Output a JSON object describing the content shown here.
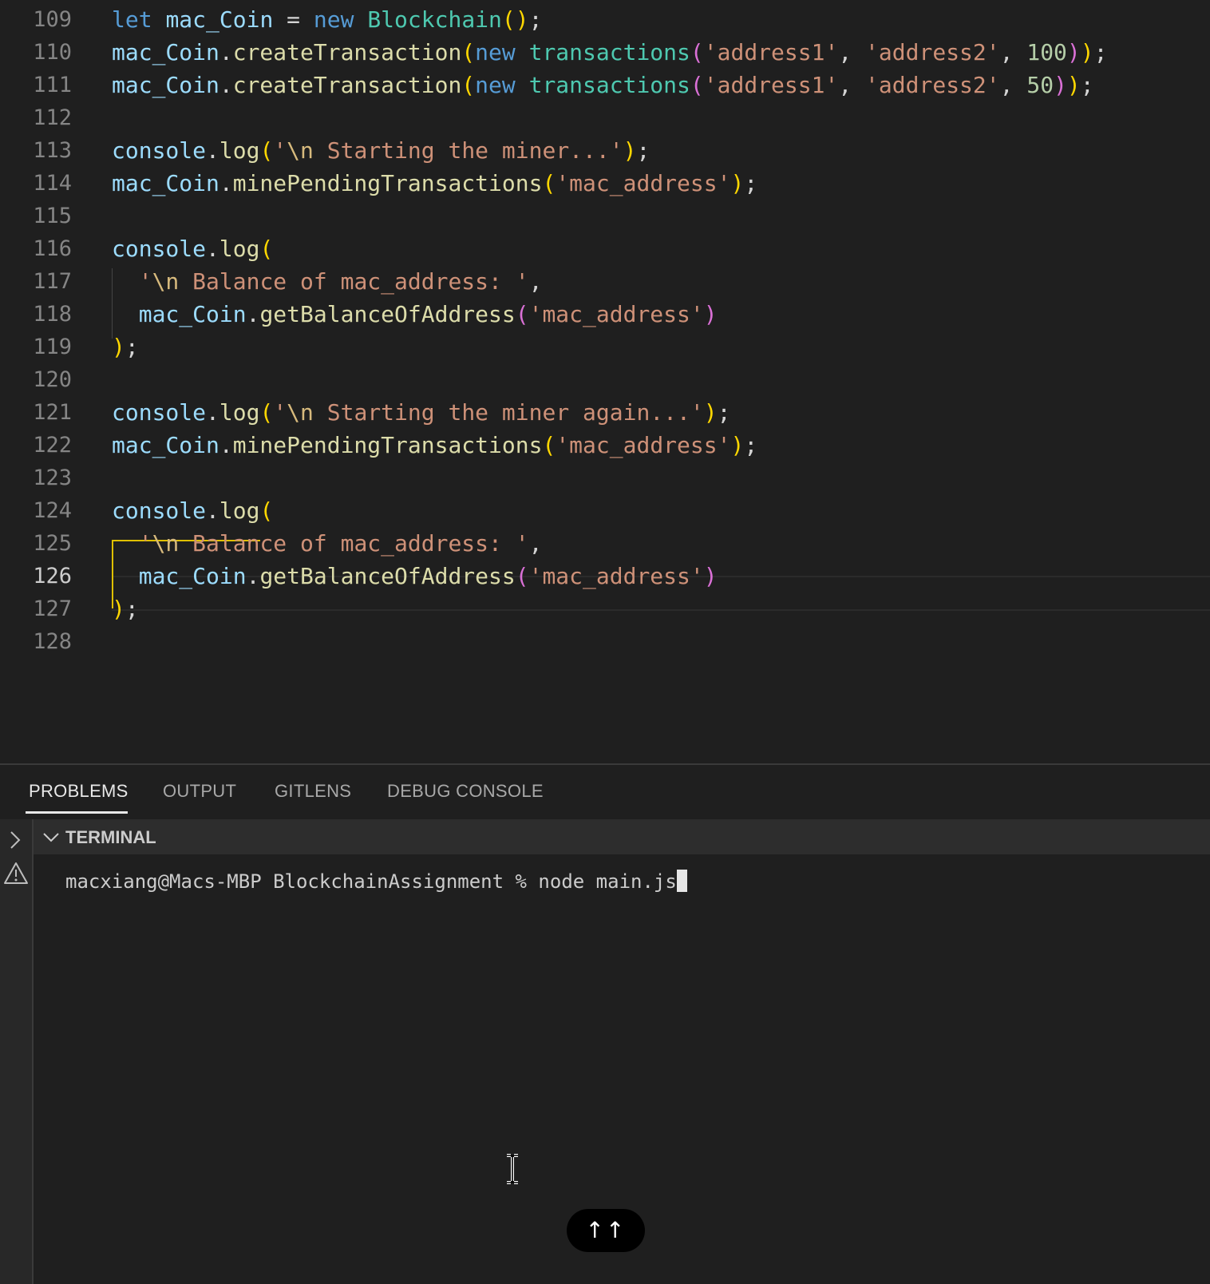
{
  "editor": {
    "lines": [
      {
        "num": "109",
        "tokens": [
          [
            "k",
            "let"
          ],
          [
            "p",
            " "
          ],
          [
            "v",
            "mac_Coin"
          ],
          [
            "p",
            " = "
          ],
          [
            "k",
            "new"
          ],
          [
            "p",
            " "
          ],
          [
            "c",
            "Blockchain"
          ],
          [
            "b1",
            "()"
          ],
          [
            "p",
            ";"
          ]
        ]
      },
      {
        "num": "110",
        "tokens": [
          [
            "v",
            "mac_Coin"
          ],
          [
            "p",
            "."
          ],
          [
            "f",
            "createTransaction"
          ],
          [
            "b1",
            "("
          ],
          [
            "k",
            "new"
          ],
          [
            "p",
            " "
          ],
          [
            "c",
            "transactions"
          ],
          [
            "b2",
            "("
          ],
          [
            "s",
            "'address1'"
          ],
          [
            "p",
            ", "
          ],
          [
            "s",
            "'address2'"
          ],
          [
            "p",
            ", "
          ],
          [
            "n",
            "100"
          ],
          [
            "b2",
            ")"
          ],
          [
            "b1",
            ")"
          ],
          [
            "p",
            ";"
          ]
        ]
      },
      {
        "num": "111",
        "tokens": [
          [
            "v",
            "mac_Coin"
          ],
          [
            "p",
            "."
          ],
          [
            "f",
            "createTransaction"
          ],
          [
            "b1",
            "("
          ],
          [
            "k",
            "new"
          ],
          [
            "p",
            " "
          ],
          [
            "c",
            "transactions"
          ],
          [
            "b2",
            "("
          ],
          [
            "s",
            "'address1'"
          ],
          [
            "p",
            ", "
          ],
          [
            "s",
            "'address2'"
          ],
          [
            "p",
            ", "
          ],
          [
            "n",
            "50"
          ],
          [
            "b2",
            ")"
          ],
          [
            "b1",
            ")"
          ],
          [
            "p",
            ";"
          ]
        ]
      },
      {
        "num": "112",
        "tokens": []
      },
      {
        "num": "113",
        "tokens": [
          [
            "v",
            "console"
          ],
          [
            "p",
            "."
          ],
          [
            "f",
            "log"
          ],
          [
            "b1",
            "("
          ],
          [
            "s",
            "'"
          ],
          [
            "e",
            "\\n"
          ],
          [
            "s",
            " Starting the miner...'"
          ],
          [
            "b1",
            ")"
          ],
          [
            "p",
            ";"
          ]
        ]
      },
      {
        "num": "114",
        "tokens": [
          [
            "v",
            "mac_Coin"
          ],
          [
            "p",
            "."
          ],
          [
            "f",
            "minePendingTransactions"
          ],
          [
            "b1",
            "("
          ],
          [
            "s",
            "'mac_address'"
          ],
          [
            "b1",
            ")"
          ],
          [
            "p",
            ";"
          ]
        ]
      },
      {
        "num": "115",
        "tokens": []
      },
      {
        "num": "116",
        "tokens": [
          [
            "v",
            "console"
          ],
          [
            "p",
            "."
          ],
          [
            "f",
            "log"
          ],
          [
            "b1",
            "("
          ]
        ]
      },
      {
        "num": "117",
        "tokens": [
          [
            "p",
            "  "
          ],
          [
            "s",
            "'"
          ],
          [
            "e",
            "\\n"
          ],
          [
            "s",
            " Balance of mac_address: '"
          ],
          [
            "p",
            ","
          ]
        ]
      },
      {
        "num": "118",
        "tokens": [
          [
            "p",
            "  "
          ],
          [
            "v",
            "mac_Coin"
          ],
          [
            "p",
            "."
          ],
          [
            "f",
            "getBalanceOfAddress"
          ],
          [
            "b2",
            "("
          ],
          [
            "s",
            "'mac_address'"
          ],
          [
            "b2",
            ")"
          ]
        ]
      },
      {
        "num": "119",
        "tokens": [
          [
            "b1",
            ")"
          ],
          [
            "p",
            ";"
          ]
        ]
      },
      {
        "num": "120",
        "tokens": []
      },
      {
        "num": "121",
        "tokens": [
          [
            "v",
            "console"
          ],
          [
            "p",
            "."
          ],
          [
            "f",
            "log"
          ],
          [
            "b1",
            "("
          ],
          [
            "s",
            "'"
          ],
          [
            "e",
            "\\n"
          ],
          [
            "s",
            " Starting the miner again...'"
          ],
          [
            "b1",
            ")"
          ],
          [
            "p",
            ";"
          ]
        ]
      },
      {
        "num": "122",
        "tokens": [
          [
            "v",
            "mac_Coin"
          ],
          [
            "p",
            "."
          ],
          [
            "f",
            "minePendingTransactions"
          ],
          [
            "b1",
            "("
          ],
          [
            "s",
            "'mac_address'"
          ],
          [
            "b1",
            ")"
          ],
          [
            "p",
            ";"
          ]
        ]
      },
      {
        "num": "123",
        "tokens": []
      },
      {
        "num": "124",
        "tokens": [
          [
            "v",
            "console"
          ],
          [
            "p",
            "."
          ],
          [
            "f",
            "log"
          ],
          [
            "b1",
            "("
          ]
        ]
      },
      {
        "num": "125",
        "tokens": [
          [
            "p",
            "  "
          ],
          [
            "s",
            "'"
          ],
          [
            "e",
            "\\n"
          ],
          [
            "s",
            " Balance of mac_address: '"
          ],
          [
            "p",
            ","
          ]
        ]
      },
      {
        "num": "126",
        "tokens": [
          [
            "p",
            "  "
          ],
          [
            "v",
            "mac_Coin"
          ],
          [
            "p",
            "."
          ],
          [
            "f",
            "getBalanceOfAddress"
          ],
          [
            "b2",
            "("
          ],
          [
            "s",
            "'mac_address'"
          ],
          [
            "b2",
            ")"
          ]
        ]
      },
      {
        "num": "127",
        "tokens": [
          [
            "b1",
            ")"
          ],
          [
            "p",
            ";"
          ]
        ]
      },
      {
        "num": "128",
        "tokens": []
      }
    ],
    "active_line": "126"
  },
  "panel": {
    "tabs": [
      "PROBLEMS",
      "OUTPUT",
      "GITLENS",
      "DEBUG CONSOLE"
    ],
    "active_tab": "PROBLEMS",
    "section_title": "TERMINAL",
    "terminal_prompt": "macxiang@Macs-MBP BlockchainAssignment % node main.js",
    "scroll_button_label": "↑↑"
  },
  "icons": {
    "activity": [
      "chevron-right-icon",
      "warning-icon"
    ],
    "section": "chevron-down-icon",
    "mouse": "text-cursor-icon"
  },
  "colors": {
    "background": "#1f1f1f",
    "bracket_guide": "#e0c000",
    "keyword": "#569cd6",
    "string": "#ce9178"
  }
}
